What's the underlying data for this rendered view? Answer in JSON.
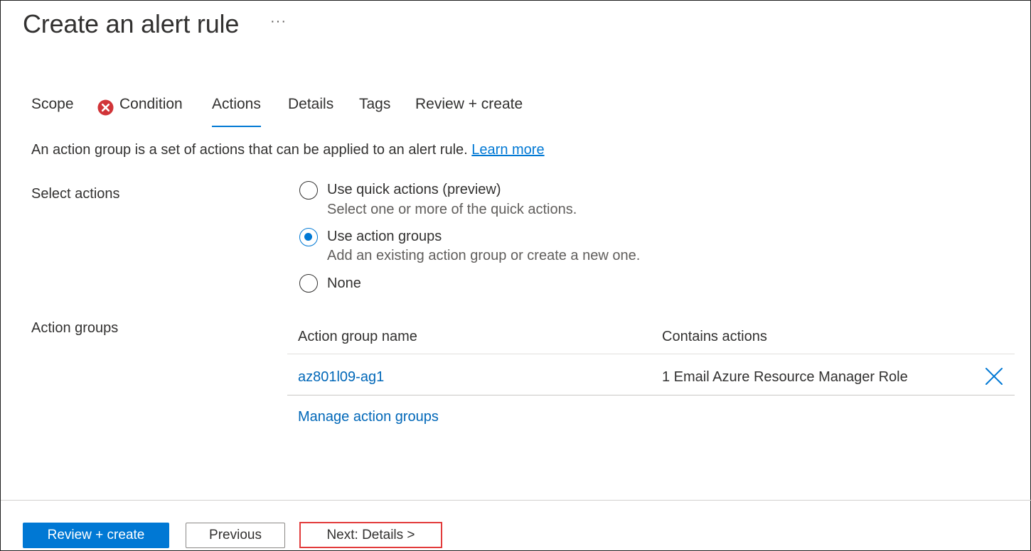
{
  "header": {
    "title": "Create an alert rule",
    "more_label": "···"
  },
  "tabs": [
    {
      "label": "Scope",
      "active": false,
      "error": false
    },
    {
      "label": "Condition",
      "active": false,
      "error": true
    },
    {
      "label": "Actions",
      "active": true,
      "error": false
    },
    {
      "label": "Details",
      "active": false,
      "error": false
    },
    {
      "label": "Tags",
      "active": false,
      "error": false
    },
    {
      "label": "Review + create",
      "active": false,
      "error": false
    }
  ],
  "description": {
    "text": "An action group is a set of actions that can be applied to an alert rule.",
    "link": "Learn more"
  },
  "select_actions": {
    "label": "Select actions",
    "options": [
      {
        "label": "Use quick actions (preview)",
        "sub": "Select one or more of the quick actions.",
        "checked": false
      },
      {
        "label": "Use action groups",
        "sub": "Add an existing action group or create a new one.",
        "checked": true
      },
      {
        "label": "None",
        "sub": "",
        "checked": false
      }
    ]
  },
  "action_groups": {
    "label": "Action groups",
    "columns": [
      "Action group name",
      "Contains actions"
    ],
    "rows": [
      {
        "name": "az801l09-ag1",
        "actions": "1 Email Azure Resource Manager Role"
      }
    ],
    "manage_link": "Manage action groups"
  },
  "footer": {
    "review_create": "Review + create",
    "previous": "Previous",
    "next": "Next: Details >"
  },
  "colors": {
    "accent": "#0078d4",
    "error": "#d13438",
    "highlight_border": "#e23b3b"
  },
  "icons": {
    "condition_error": "error-circle-icon",
    "remove_row": "close-icon"
  }
}
